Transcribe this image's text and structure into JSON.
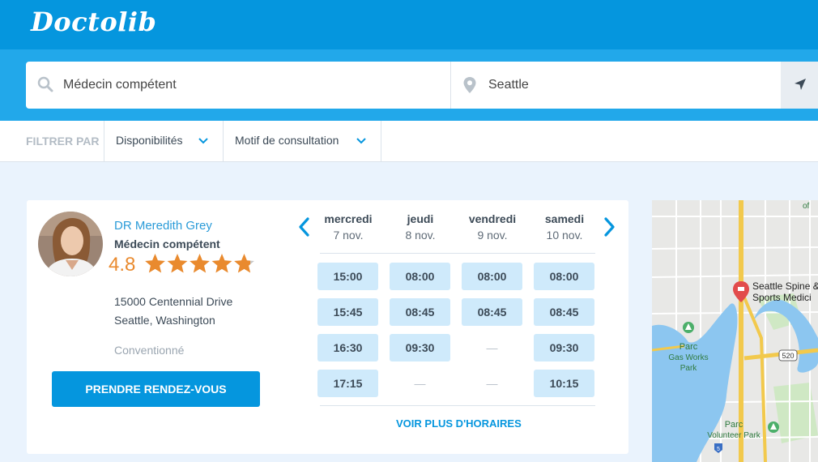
{
  "header": {
    "logo": "Doctolib"
  },
  "search": {
    "specialty_value": "Médecin compétent",
    "location_value": "Seattle"
  },
  "filters": {
    "label": "FILTRER PAR",
    "availability": "Disponibilités",
    "reason": "Motif de consultation"
  },
  "doctor": {
    "name": "DR Meredith Grey",
    "specialty": "Médecin compétent",
    "rating": "4.8",
    "rating_value": 4.8,
    "rating_max": 5,
    "address_line1": "15000 Centennial Drive",
    "address_line2": "Seattle, Washington",
    "convention": "Conventionné",
    "book_label": "PRENDRE RENDEZ-VOUS"
  },
  "schedule": {
    "days": [
      {
        "name": "mercredi",
        "date": "7 nov.",
        "slots": [
          "15:00",
          "15:45",
          "16:30",
          "17:15"
        ]
      },
      {
        "name": "jeudi",
        "date": "8 nov.",
        "slots": [
          "08:00",
          "08:45",
          "09:30",
          "—"
        ]
      },
      {
        "name": "vendredi",
        "date": "9 nov.",
        "slots": [
          "08:00",
          "08:45",
          "—",
          "—"
        ]
      },
      {
        "name": "samedi",
        "date": "10 nov.",
        "slots": [
          "08:00",
          "08:45",
          "09:30",
          "10:15"
        ]
      }
    ],
    "more_label": "VOIR PLUS D'HORAIRES"
  },
  "map": {
    "poi_name_1": "Seattle Spine &",
    "poi_name_2": "Sports Medici",
    "park1_a": "Parc",
    "park1_b": "Gas Works",
    "park1_c": "Park",
    "park2_a": "Parc",
    "park2_b": "Volunteer Park",
    "route_520": "520",
    "route_5": "5",
    "edge_label": "of"
  },
  "colors": {
    "brand_blue": "#0596de",
    "search_band": "#22a8ea",
    "star_orange": "#e98a2e",
    "slot_bg": "#cfeafb"
  }
}
